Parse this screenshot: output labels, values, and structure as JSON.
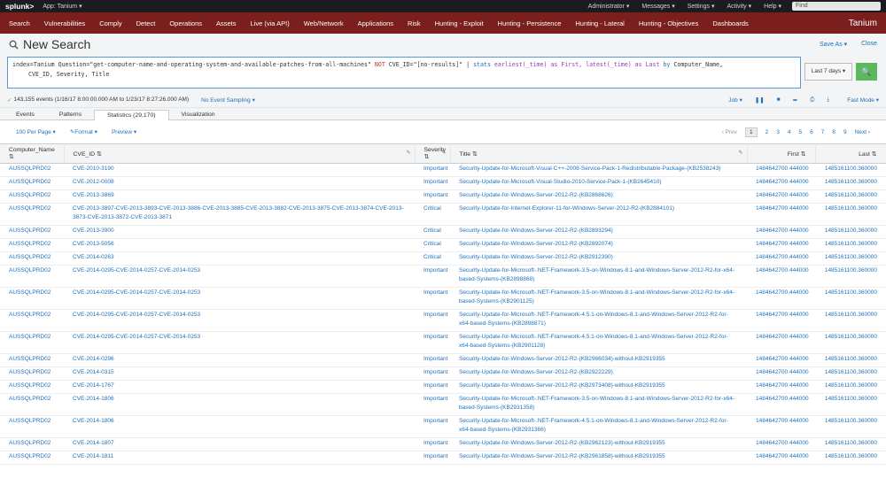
{
  "topbar": {
    "logo": "splunk>",
    "app": "App: Tanium ▾",
    "items": [
      "Administrator ▾",
      "Messages ▾",
      "Settings ▾",
      "Activity ▾",
      "Help ▾"
    ],
    "find": "Find"
  },
  "appbar": {
    "items": [
      "Search",
      "Vulnerabilities",
      "Comply",
      "Detect",
      "Operations",
      "Assets",
      "Live (via API)",
      "Web/Network",
      "Applications",
      "Risk",
      "Hunting - Exploit",
      "Hunting - Persistence",
      "Hunting - Lateral",
      "Hunting - Objectives",
      "Dashboards"
    ],
    "brand": "Tanium"
  },
  "search": {
    "title": "New Search",
    "save_as": "Save As ▾",
    "close": "Close",
    "query": {
      "part1": "index=Tanium Question=\"get-computer-name-and-operating-system-and-available-patches-from-all-machines\" ",
      "not": "NOT",
      "part2": " CVE_ID=\"[no-results]\" | ",
      "stats": "stats",
      "part3": " earliest(_time) as First, latest(_time) as Last ",
      "by": "by",
      "part4": " Computer_Name,",
      "line2": "CVE_ID, Severity, Title"
    },
    "time_range": "Last 7 days ▾",
    "go": "🔍"
  },
  "status": {
    "events": "143,155 events (1/16/17 8:00:00.000 AM to 1/23/17 8:27:26.000 AM)",
    "sampling": "No Event Sampling ▾",
    "job": "Job ▾",
    "mode": "Fast Mode ▾"
  },
  "tabs": [
    "Events",
    "Patterns",
    "Statistics (29,170)",
    "Visualization"
  ],
  "tools": {
    "per_page": "100 Per Page ▾",
    "format": "✎Format ▾",
    "preview": "Preview ▾",
    "prev": "‹ Prev",
    "pages": [
      "1",
      "2",
      "3",
      "4",
      "5",
      "6",
      "7",
      "8",
      "9"
    ],
    "next": "Next ›"
  },
  "columns": [
    "Computer_Name ⇅",
    "CVE_ID ⇅",
    "Severity ⇅",
    "Title ⇅",
    "First ⇅",
    "Last ⇅"
  ],
  "rows": [
    {
      "c": "AUSSQLPRD02",
      "cve": "CVE-2010-3190",
      "sev": "Important",
      "title": "Security-Update-for-Microsoft-Visual-C++-2008-Service-Pack-1-Redistributable-Package-(KB2538243)",
      "f": "1484642700.444000",
      "l": "1485161100.360000"
    },
    {
      "c": "AUSSQLPRD02",
      "cve": "CVE-2012-0008",
      "sev": "Important",
      "title": "Security-Update-for-Microsoft-Visual-Studio-2010-Service-Pack-1-(KB2645410)",
      "f": "1484642700.444000",
      "l": "1485161100.360000"
    },
    {
      "c": "AUSSQLPRD02",
      "cve": "CVE-2013-3869",
      "sev": "Important",
      "title": "Security-Update-for-Windows-Server-2012-R2-(KB2868626)",
      "f": "1484642700.444000",
      "l": "1485161100.360000"
    },
    {
      "c": "AUSSQLPRD02",
      "cve": "CVE-2013-3897-CVE-2013-3893-CVE-2013-3886-CVE-2013-3885-CVE-2013-3882-CVE-2013-3875-CVE-2013-3874-CVE-2013-3873-CVE-2013-3872-CVE-2013-3871",
      "sev": "Critical",
      "title": "Security-Update-for-Internet-Explorer-11-for-Windows-Server-2012-R2-(KB2884101)",
      "f": "1484642700.444000",
      "l": "1485161100.360000"
    },
    {
      "c": "AUSSQLPRD02",
      "cve": "CVE-2013-3900",
      "sev": "Critical",
      "title": "Security-Update-for-Windows-Server-2012-R2-(KB2893294)",
      "f": "1484642700.444000",
      "l": "1485161100.360000"
    },
    {
      "c": "AUSSQLPRD02",
      "cve": "CVE-2013-5056",
      "sev": "Critical",
      "title": "Security-Update-for-Windows-Server-2012-R2-(KB2892074)",
      "f": "1484642700.444000",
      "l": "1485161100.360000"
    },
    {
      "c": "AUSSQLPRD02",
      "cve": "CVE-2014-0263",
      "sev": "Critical",
      "title": "Security-Update-for-Windows-Server-2012-R2-(KB2912390)",
      "f": "1484642700.444000",
      "l": "1485161100.360000"
    },
    {
      "c": "AUSSQLPRD02",
      "cve": "CVE-2014-0295-CVE-2014-0257-CVE-2014-0253",
      "sev": "Important",
      "title": "Security-Update-for-Microsoft-.NET-Framework-3.5-on-Windows-8.1-and-Windows-Server-2012-R2-for-x64-based-Systems-(KB2898868)",
      "f": "1484642700.444000",
      "l": "1485161100.360000"
    },
    {
      "c": "AUSSQLPRD02",
      "cve": "CVE-2014-0295-CVE-2014-0257-CVE-2014-0253",
      "sev": "Important",
      "title": "Security-Update-for-Microsoft-.NET-Framework-3.5-on-Windows-8.1-and-Windows-Server-2012-R2-for-x64-based-Systems-(KB2901125)",
      "f": "1484642700.444000",
      "l": "1485161100.360000"
    },
    {
      "c": "AUSSQLPRD02",
      "cve": "CVE-2014-0295-CVE-2014-0257-CVE-2014-0253",
      "sev": "Important",
      "title": "Security-Update-for-Microsoft-.NET-Framework-4.5.1-on-Windows-8.1-and-Windows-Server-2012-R2-for-x64-based-Systems-(KB2898871)",
      "f": "1484642700.444000",
      "l": "1485161100.360000"
    },
    {
      "c": "AUSSQLPRD02",
      "cve": "CVE-2014-0295-CVE-2014-0257-CVE-2014-0253",
      "sev": "Important",
      "title": "Security-Update-for-Microsoft-.NET-Framework-4.5.1-on-Windows-8.1-and-Windows-Server-2012-R2-for-x64-based-Systems-(KB2901128)",
      "f": "1484642700.444000",
      "l": "1485161100.360000"
    },
    {
      "c": "AUSSQLPRD02",
      "cve": "CVE-2014-0296",
      "sev": "Important",
      "title": "Security-Update-for-Windows-Server-2012-R2-(KB2966034)-without-KB2919355",
      "f": "1484642700.444000",
      "l": "1485161100.360000"
    },
    {
      "c": "AUSSQLPRD02",
      "cve": "CVE-2014-0315",
      "sev": "Important",
      "title": "Security-Update-for-Windows-Server-2012-R2-(KB2922229)",
      "f": "1484642700.444000",
      "l": "1485161100.360000"
    },
    {
      "c": "AUSSQLPRD02",
      "cve": "CVE-2014-1767",
      "sev": "Important",
      "title": "Security-Update-for-Windows-Server-2012-R2-(KB2973408)-without-KB2919355",
      "f": "1484642700.444000",
      "l": "1485161100.360000"
    },
    {
      "c": "AUSSQLPRD02",
      "cve": "CVE-2014-1806",
      "sev": "Important",
      "title": "Security-Update-for-Microsoft-.NET-Framework-3.5-on-Windows-8.1-and-Windows-Server-2012-R2-for-x64-based-Systems-(KB2931358)",
      "f": "1484642700.444000",
      "l": "1485161100.360000"
    },
    {
      "c": "AUSSQLPRD02",
      "cve": "CVE-2014-1806",
      "sev": "Important",
      "title": "Security-Update-for-Microsoft-.NET-Framework-4.5.1-on-Windows-8.1-and-Windows-Server-2012-R2-for-x64-based-Systems-(KB2931366)",
      "f": "1484642700.444000",
      "l": "1485161100.360000"
    },
    {
      "c": "AUSSQLPRD02",
      "cve": "CVE-2014-1807",
      "sev": "Important",
      "title": "Security-Update-for-Windows-Server-2012-R2-(KB2962123)-without-KB2919355",
      "f": "1484642700.444000",
      "l": "1485161100.360000"
    },
    {
      "c": "AUSSQLPRD02",
      "cve": "CVE-2014-1811",
      "sev": "Important",
      "title": "Security-Update-for-Windows-Server-2012-R2-(KB2961858)-without-KB2919355",
      "f": "1484642700.444000",
      "l": "1485161100.360000"
    }
  ]
}
